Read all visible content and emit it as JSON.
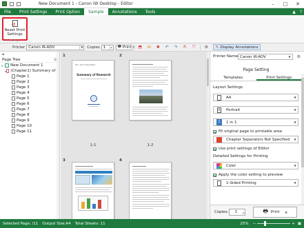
{
  "window": {
    "title": "New Document 1 - Canon iW Desktop - Editor",
    "minimize": "–",
    "maximize": "□",
    "close": "✕"
  },
  "menu": {
    "tabs": [
      "File",
      "Print Settings",
      "Print Option",
      "Sample",
      "Annotations",
      "Tools"
    ],
    "active": "Sample"
  },
  "ribbon": {
    "reset_label": "Reset Print Settings",
    "group_label": "Settings"
  },
  "toolbar": {
    "printer_label": "Printer",
    "printer_value": "Canon iR-ADV",
    "copies_label": "Copies",
    "copies_value": "1",
    "print_label": "Print",
    "display_annotations": "Display Annotations"
  },
  "tree": {
    "title": "Page Tree",
    "root": "New Document 1",
    "chapter": "(Chapter1) Summary of R",
    "pages": [
      "Page 1",
      "Page 2",
      "Page 3",
      "Page 4",
      "Page 5",
      "Page 6",
      "Page 7",
      "Page 8",
      "Page 9",
      "Page 10",
      "Page 11"
    ]
  },
  "pages_view": {
    "page_numbers": [
      "1",
      "2",
      "3",
      "4"
    ],
    "page_labels": [
      "1-1",
      "1-2"
    ],
    "thumb1_header": "Pro. XX Corporation",
    "thumb1_title": "Summary of Research"
  },
  "settings": {
    "printer_name_label": "Printer Name:",
    "printer_name_value": "Canon iR-ADV",
    "section_title": "Page Setting",
    "tabs": [
      "Templates",
      "Print Settings"
    ],
    "active_tab": "Print Settings",
    "layout_title": "Layout Settings",
    "paper": "A4",
    "orientation": "Portrait",
    "layout": "1 in 1",
    "fit_original": "Fit original page to printable area",
    "chapter_separator": "Chapter Separators Not Specified",
    "use_print_settings": "Use print settings of Editor",
    "detailed_title": "Detailed Settings for Printing",
    "color": "Color",
    "apply_color": "Apply the color setting to preview",
    "sided": "1-Sided Printing",
    "copies_label": "Copies:",
    "copies_value": "1",
    "print_button": "Print"
  },
  "status": {
    "selected": "Selected Page: /11",
    "output_size": "Output Size:A4",
    "total_sheets": "Total Sheets: 11",
    "zoom": "25%"
  },
  "colors": {
    "brand_green": "#1f7a3e",
    "highlight_red": "#e0202e"
  }
}
